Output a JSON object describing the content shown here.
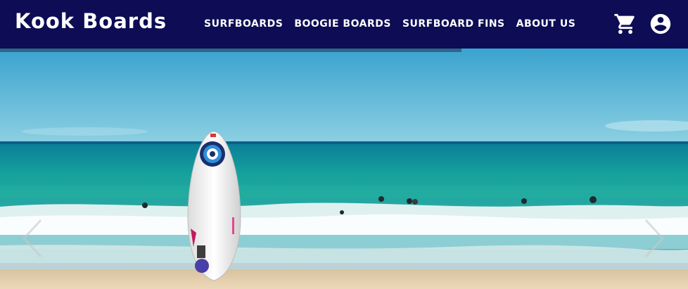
{
  "brand": {
    "name": "Kook Boards"
  },
  "nav": {
    "links": [
      {
        "label": "SURFBOARDS"
      },
      {
        "label": "BOOGIE BOARDS"
      },
      {
        "label": "SURFBOARD FINS"
      },
      {
        "label": "ABOUT US"
      }
    ]
  },
  "icons": {
    "cart": "cart-icon",
    "account": "account-circle-icon",
    "prev": "chevron-left-icon",
    "next": "chevron-right-icon"
  },
  "colors": {
    "navbar": "#0d0c55",
    "sky": "#55b6d6",
    "ocean": "#169a9c",
    "sand": "#e6cfae"
  }
}
